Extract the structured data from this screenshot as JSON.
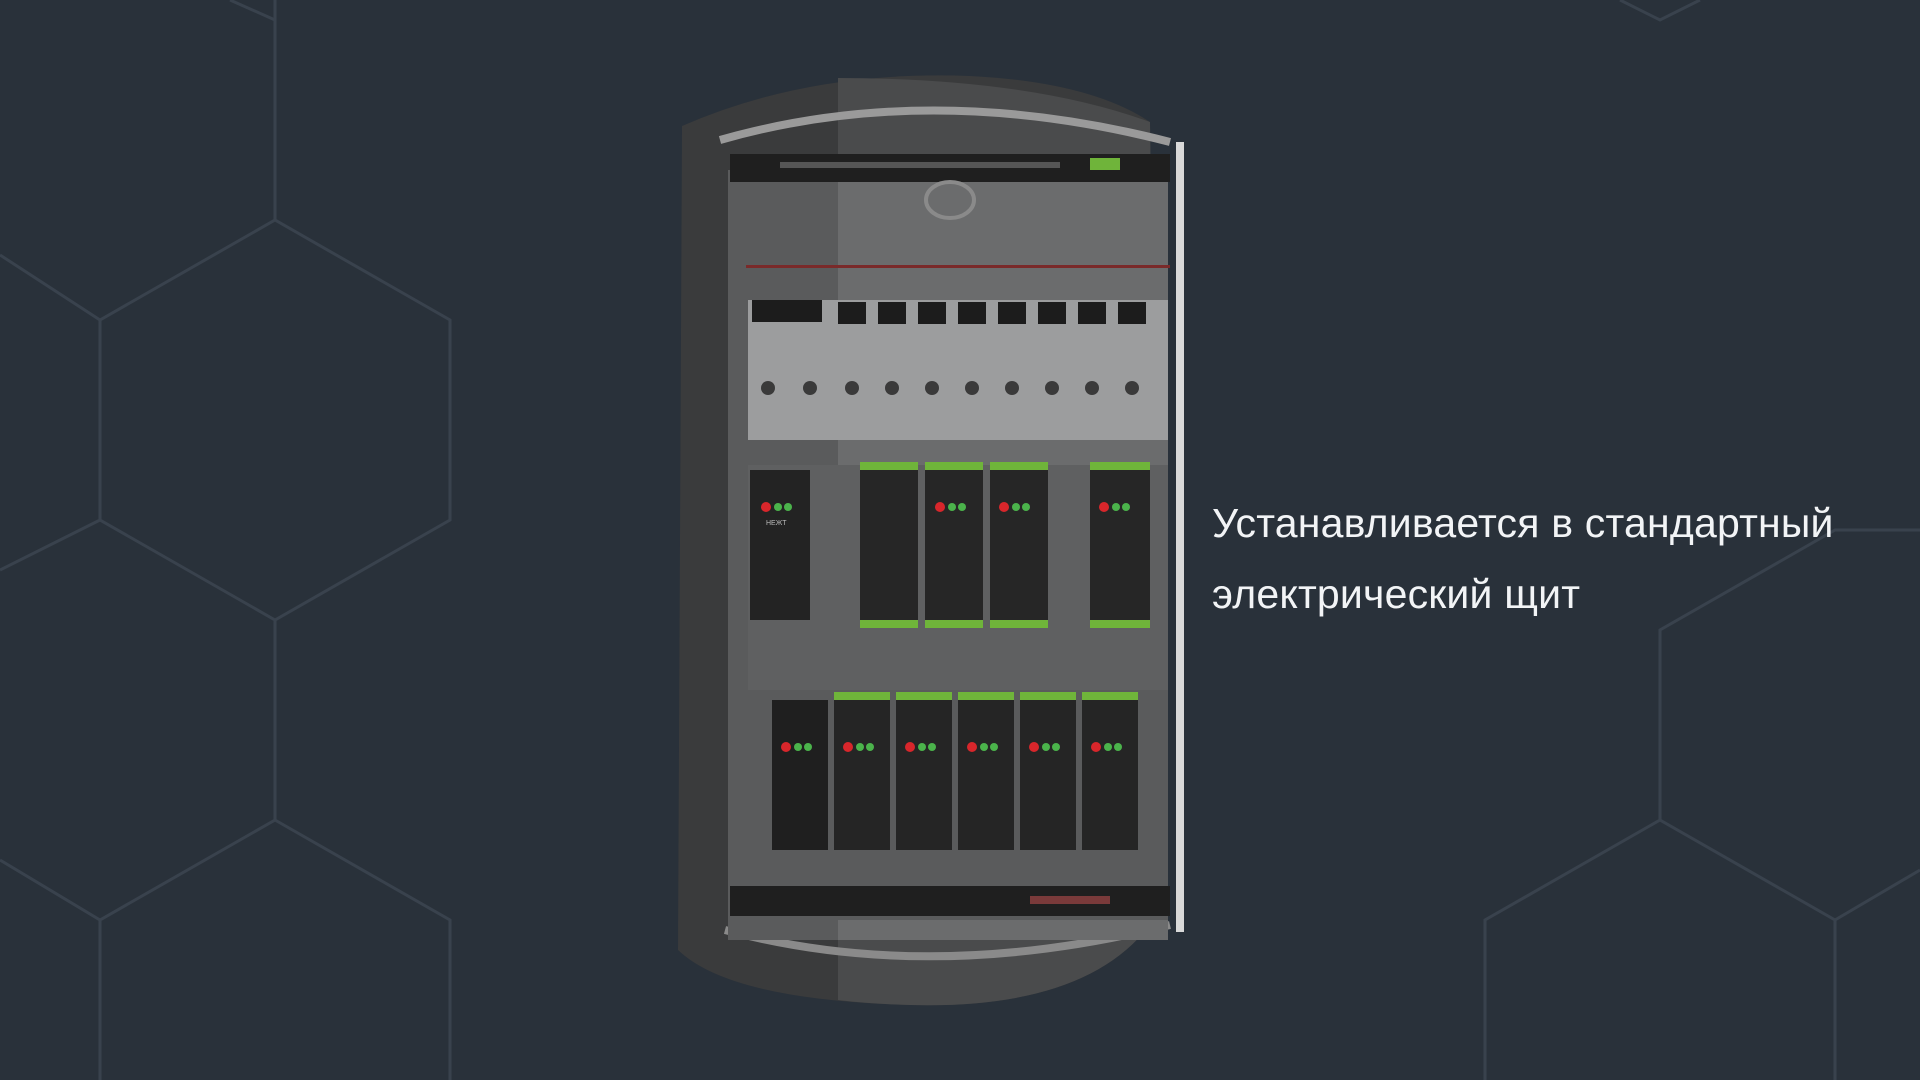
{
  "caption": {
    "line1": "Устанавливается в стандартный",
    "line2": "электрический щит"
  },
  "panel": {
    "module_labels": [
      "НЕЖТ"
    ],
    "led_colors": [
      "#d8262b",
      "#4bb34b"
    ]
  },
  "colors": {
    "background": "#29313a",
    "hex_lines": "#39424d",
    "text": "#f2f4f6",
    "terminal_green": "#6fb43a"
  }
}
